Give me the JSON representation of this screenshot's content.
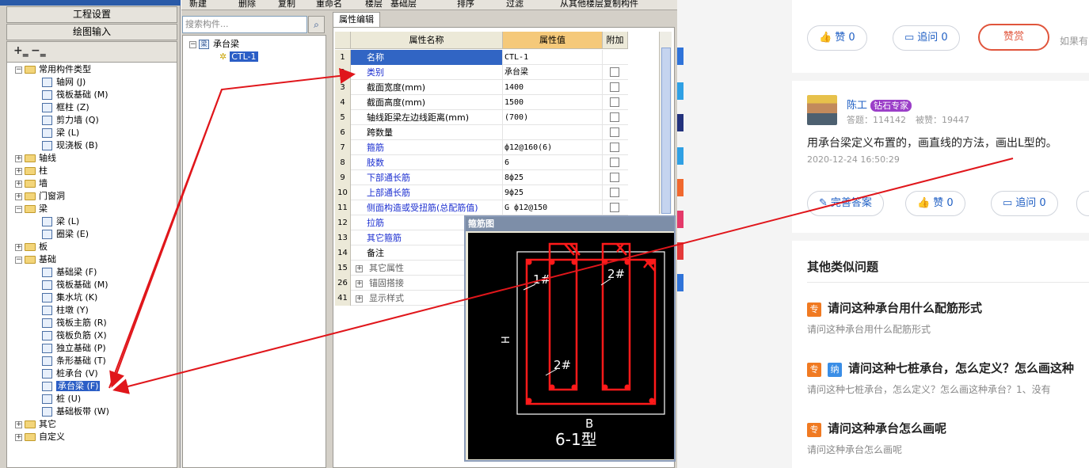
{
  "left_panel": {
    "nav_buttons": [
      "工程设置",
      "绘图输入"
    ],
    "tree": [
      {
        "label": "常用构件类型",
        "type": "folder",
        "expanded": true,
        "level": 0
      },
      {
        "label": "轴网 (J)",
        "type": "item",
        "level": 1
      },
      {
        "label": "筏板基础 (M)",
        "type": "item",
        "level": 1
      },
      {
        "label": "框柱 (Z)",
        "type": "item",
        "level": 1
      },
      {
        "label": "剪力墙 (Q)",
        "type": "item",
        "level": 1
      },
      {
        "label": "梁 (L)",
        "type": "item",
        "level": 1
      },
      {
        "label": "现浇板 (B)",
        "type": "item",
        "level": 1
      },
      {
        "label": "轴线",
        "type": "folder",
        "expanded": false,
        "level": 0
      },
      {
        "label": "柱",
        "type": "folder",
        "expanded": false,
        "level": 0
      },
      {
        "label": "墙",
        "type": "folder",
        "expanded": false,
        "level": 0
      },
      {
        "label": "门窗洞",
        "type": "folder",
        "expanded": false,
        "level": 0
      },
      {
        "label": "梁",
        "type": "folder",
        "expanded": true,
        "level": 0
      },
      {
        "label": "梁 (L)",
        "type": "item",
        "level": 1
      },
      {
        "label": "圈梁 (E)",
        "type": "item",
        "level": 1
      },
      {
        "label": "板",
        "type": "folder",
        "expanded": false,
        "level": 0
      },
      {
        "label": "基础",
        "type": "folder",
        "expanded": true,
        "level": 0
      },
      {
        "label": "基础梁 (F)",
        "type": "item",
        "level": 1
      },
      {
        "label": "筏板基础 (M)",
        "type": "item",
        "level": 1
      },
      {
        "label": "集水坑 (K)",
        "type": "item",
        "level": 1
      },
      {
        "label": "柱墩 (Y)",
        "type": "item",
        "level": 1
      },
      {
        "label": "筏板主筋 (R)",
        "type": "item",
        "level": 1
      },
      {
        "label": "筏板负筋 (X)",
        "type": "item",
        "level": 1
      },
      {
        "label": "独立基础 (P)",
        "type": "item",
        "level": 1
      },
      {
        "label": "条形基础 (T)",
        "type": "item",
        "level": 1
      },
      {
        "label": "桩承台 (V)",
        "type": "item",
        "level": 1
      },
      {
        "label": "承台梁 (F)",
        "type": "item",
        "level": 1,
        "selected": true
      },
      {
        "label": "桩 (U)",
        "type": "item",
        "level": 1
      },
      {
        "label": "基础板带 (W)",
        "type": "item",
        "level": 1
      },
      {
        "label": "其它",
        "type": "folder",
        "expanded": false,
        "level": 0
      },
      {
        "label": "自定义",
        "type": "folder",
        "expanded": false,
        "level": 0
      }
    ]
  },
  "toolbar": {
    "items": [
      "新建",
      "删除",
      "复制",
      "重命名",
      "楼层",
      "基础层",
      "排序",
      "过滤",
      "从其他楼层复制构件"
    ]
  },
  "component_tree": {
    "search_placeholder": "搜索构件...",
    "root": "承台梁",
    "child": "CTL-1"
  },
  "property_grid": {
    "tab": "属性编辑",
    "headers": [
      "属性名称",
      "属性值",
      "附加"
    ],
    "rows": [
      {
        "num": "1",
        "name": "名称",
        "value": "CTL-1",
        "style": "selected",
        "check": false
      },
      {
        "num": "2",
        "name": "类别",
        "value": "承台梁",
        "style": "blue",
        "check": true
      },
      {
        "num": "3",
        "name": "截面宽度(mm)",
        "value": "1400",
        "style": "plain",
        "check": true
      },
      {
        "num": "4",
        "name": "截面高度(mm)",
        "value": "1500",
        "style": "plain",
        "check": true
      },
      {
        "num": "5",
        "name": "轴线距梁左边线距离(mm)",
        "value": "(700)",
        "style": "plain",
        "check": true
      },
      {
        "num": "6",
        "name": "跨数量",
        "value": "",
        "style": "plain",
        "check": true
      },
      {
        "num": "7",
        "name": "箍筋",
        "value": "ф12@160(6)",
        "style": "blue",
        "check": true
      },
      {
        "num": "8",
        "name": "肢数",
        "value": "6",
        "style": "blue",
        "check": true
      },
      {
        "num": "9",
        "name": "下部通长筋",
        "value": "8ф25",
        "style": "blue",
        "check": true
      },
      {
        "num": "10",
        "name": "上部通长筋",
        "value": "9ф25",
        "style": "blue",
        "check": true
      },
      {
        "num": "11",
        "name": "侧面构造或受扭筋(总配筋值)",
        "value": "G ф12@150",
        "style": "blue",
        "check": true
      },
      {
        "num": "12",
        "name": "拉筋",
        "value": "",
        "style": "blue",
        "check": false
      },
      {
        "num": "13",
        "name": "其它箍筋",
        "value": "",
        "style": "blue",
        "check": false
      },
      {
        "num": "14",
        "name": "备注",
        "value": "",
        "style": "plain",
        "check": false
      },
      {
        "num": "15",
        "name": "其它属性",
        "value": "",
        "style": "group",
        "check": false
      },
      {
        "num": "26",
        "name": "锚固搭接",
        "value": "",
        "style": "group",
        "check": false
      },
      {
        "num": "41",
        "name": "显示样式",
        "value": "",
        "style": "group",
        "check": false
      }
    ]
  },
  "stirrup_window": {
    "title": "箍筋图",
    "labels": {
      "l1": "1#",
      "l2a": "2#",
      "l2b": "2#",
      "h": "H",
      "b": "B",
      "type": "6-1型"
    }
  },
  "web": {
    "top_actions": {
      "like": "赞 0",
      "ask": "追问 0",
      "reward": "赞赏",
      "more": "如果有"
    },
    "answer": {
      "user": "陈工",
      "badge": "钻石专家",
      "answers_label": "答题：",
      "answers_count": "114142",
      "likes_label": "被赞：",
      "likes_count": "19447",
      "text": "用承台梁定义布置的，画直线的方法，画出L型的。",
      "time": "2020-12-24 16:50:29",
      "btn_improve": "完善答案",
      "btn_like": "赞 0",
      "btn_ask": "追问 0"
    },
    "similar": {
      "heading": "其他类似问题",
      "tag_zhuan": "专",
      "tag_na": "纳",
      "items": [
        {
          "title": "请问这种承台用什么配筋形式",
          "desc": "请问这种承台用什么配筋形式",
          "tags": [
            "专"
          ]
        },
        {
          "title": "请问这种七桩承台，怎么定义？怎么画这种",
          "desc": "请问这种七桩承台，怎么定义？怎么画这种承台？1、没有",
          "tags": [
            "专",
            "纳"
          ]
        },
        {
          "title": "请问这种承台怎么画呢",
          "desc": "请问这种承台怎么画呢",
          "tags": [
            "专"
          ]
        }
      ]
    }
  },
  "colors": {
    "arrow": "#e0161b",
    "selection": "#2b5ec6",
    "link": "#1c2fd0",
    "accent_red": "#e0553c",
    "badge_purple": "#9b3ec8"
  }
}
